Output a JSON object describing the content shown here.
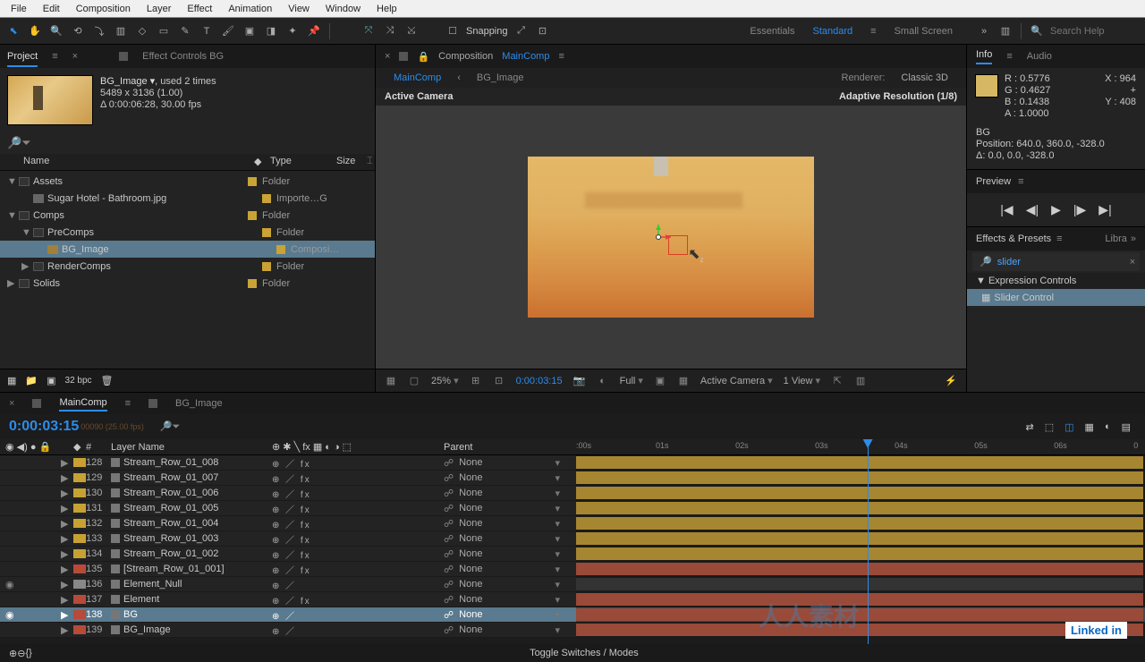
{
  "menu": [
    "File",
    "Edit",
    "Composition",
    "Layer",
    "Effect",
    "Animation",
    "View",
    "Window",
    "Help"
  ],
  "toolbar": {
    "snapping": "Snapping"
  },
  "workspace": {
    "tabs": [
      "Essentials",
      "Standard",
      "Small Screen"
    ],
    "active": 1,
    "search_placeholder": "Search Help"
  },
  "project": {
    "tab_project": "Project",
    "tab_effect": "Effect Controls BG",
    "item_name": "BG_Image  ▾",
    "used": ", used 2 times",
    "dims": "5489 x 3136 (1.00)",
    "dur": "Δ 0:00:06:28, 30.00 fps",
    "cols": {
      "name": "Name",
      "tag": "◆",
      "type": "Type",
      "size": "Size"
    },
    "tree": [
      {
        "ind": 0,
        "tw": "▼",
        "icon": "folder",
        "name": "Assets",
        "type": "Folder"
      },
      {
        "ind": 1,
        "tw": "",
        "icon": "file",
        "name": "Sugar Hotel - Bathroom.jpg",
        "type": "Importe…G"
      },
      {
        "ind": 0,
        "tw": "▼",
        "icon": "folder",
        "name": "Comps",
        "type": "Folder"
      },
      {
        "ind": 1,
        "tw": "▼",
        "icon": "folder",
        "name": "PreComps",
        "type": "Folder"
      },
      {
        "ind": 2,
        "tw": "",
        "icon": "comp",
        "name": "BG_Image",
        "type": "Composi…",
        "sel": true
      },
      {
        "ind": 1,
        "tw": "▶",
        "icon": "folder",
        "name": "RenderComps",
        "type": "Folder"
      },
      {
        "ind": 0,
        "tw": "▶",
        "icon": "folder",
        "name": "Solids",
        "type": "Folder"
      }
    ],
    "bpc": "32 bpc"
  },
  "comp_panel": {
    "prefix": "Composition",
    "name": "MainComp",
    "crumb1": "MainComp",
    "crumb2": "BG_Image",
    "renderer_l": "Renderer:",
    "renderer_v": "Classic 3D",
    "active_cam": "Active Camera",
    "adaptive": "Adaptive Resolution (1/8)"
  },
  "view_footer": {
    "zoom": "25%",
    "time": "0:00:03:15",
    "res": "Full",
    "cam": "Active Camera",
    "views": "1 View"
  },
  "info": {
    "tab_info": "Info",
    "tab_audio": "Audio",
    "r": "R : 0.5776",
    "g": "G : 0.4627",
    "b": "B : 0.1438",
    "a": "A : 1.0000",
    "x": "X : 964",
    "y": "Y : 408",
    "layer": "BG",
    "pos": "Position: 640.0, 360.0, -328.0",
    "delta": "Δ: 0.0, 0.0, -328.0"
  },
  "preview": {
    "title": "Preview"
  },
  "effects_presets": {
    "title": "Effects & Presets",
    "libra": "Libra",
    "search": "slider",
    "cat": "▼ Expression Controls",
    "item": "Slider Control"
  },
  "timeline": {
    "tab1": "MainComp",
    "tab2": "BG_Image",
    "timecode": "0:00:03:15",
    "subcode": "00090 (25.00 fps)",
    "head": {
      "num": "#",
      "name": "Layer Name",
      "parent": "Parent"
    },
    "ruler": [
      ":00s",
      "01s",
      "02s",
      "03s",
      "04s",
      "05s",
      "06s",
      "0"
    ],
    "playhead_pct": 51.2,
    "layers": [
      {
        "n": "128",
        "name": "Stream_Row_01_008",
        "sw": "y",
        "fx": "⊕   ／ fx",
        "par": "None"
      },
      {
        "n": "129",
        "name": "Stream_Row_01_007",
        "sw": "y",
        "fx": "⊕   ／ fx",
        "par": "None"
      },
      {
        "n": "130",
        "name": "Stream_Row_01_006",
        "sw": "y",
        "fx": "⊕   ／ fx",
        "par": "None"
      },
      {
        "n": "131",
        "name": "Stream_Row_01_005",
        "sw": "y",
        "fx": "⊕   ／ fx",
        "par": "None"
      },
      {
        "n": "132",
        "name": "Stream_Row_01_004",
        "sw": "y",
        "fx": "⊕   ／ fx",
        "par": "None"
      },
      {
        "n": "133",
        "name": "Stream_Row_01_003",
        "sw": "y",
        "fx": "⊕   ／ fx",
        "par": "None"
      },
      {
        "n": "134",
        "name": "Stream_Row_01_002",
        "sw": "y",
        "fx": "⊕   ／ fx",
        "par": "None"
      },
      {
        "n": "135",
        "name": "[Stream_Row_01_001]",
        "sw": "r",
        "fx": "⊕   ／ fx",
        "par": "None"
      },
      {
        "n": "136",
        "name": "Element_Null",
        "sw": "g",
        "fx": "⊕   ／",
        "par": "None",
        "eye": true
      },
      {
        "n": "137",
        "name": "Element",
        "sw": "r",
        "fx": "⊕   ／ fx",
        "par": "None"
      },
      {
        "n": "138",
        "name": "BG",
        "sw": "r",
        "fx": "⊕   ／",
        "par": "None",
        "sel": true,
        "eye": true
      },
      {
        "n": "139",
        "name": "BG_Image",
        "sw": "r",
        "fx": "⊕   ／",
        "par": "None"
      }
    ],
    "toggle": "Toggle Switches / Modes"
  },
  "watermark": "人人素材",
  "brand": "Linked in"
}
